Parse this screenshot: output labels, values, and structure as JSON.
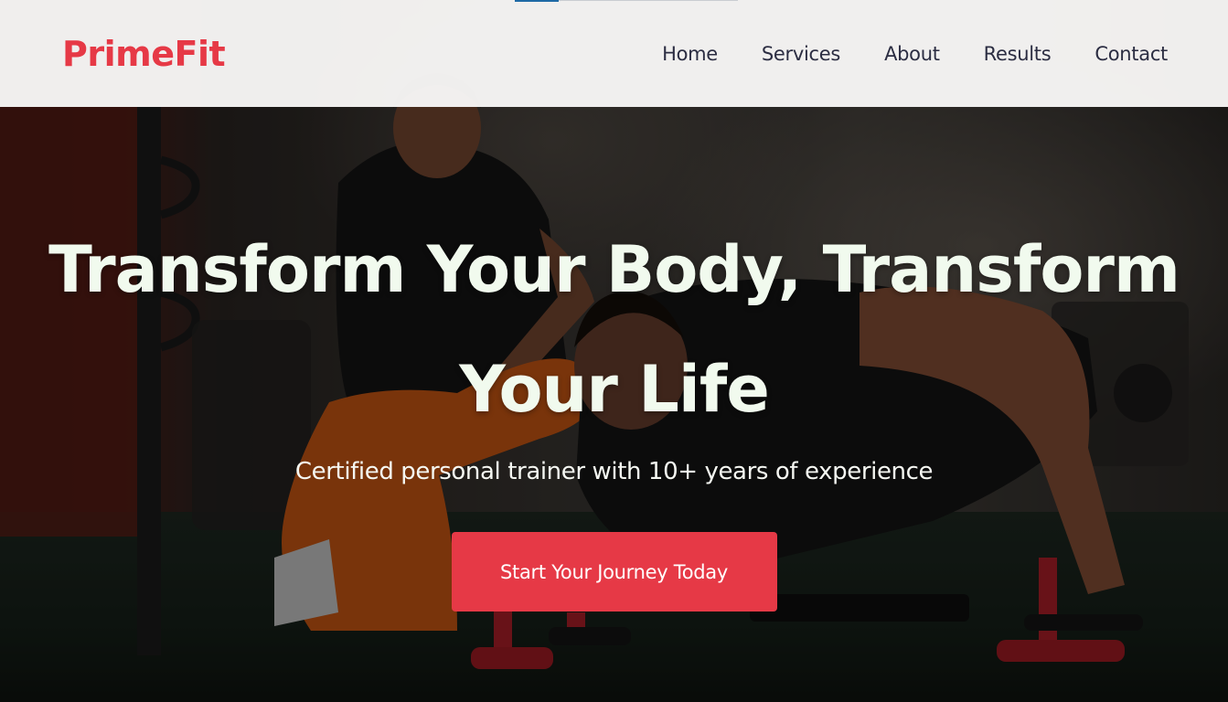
{
  "brand": {
    "logo_text": "PrimeFit",
    "accent_color": "#e63946",
    "text_dark": "#2b2d42",
    "text_light": "#f1faee"
  },
  "nav": {
    "items": [
      {
        "label": "Home"
      },
      {
        "label": "Services"
      },
      {
        "label": "About"
      },
      {
        "label": "Results"
      },
      {
        "label": "Contact"
      }
    ]
  },
  "hero": {
    "title_line1": "Transform Your Body, Transform",
    "title_line2": "Your Life",
    "subtitle": "Certified personal trainer with 10+ years of experience",
    "cta_label": "Start Your Journey Today",
    "background_image": "trainer-assisting-push-up-photo"
  }
}
